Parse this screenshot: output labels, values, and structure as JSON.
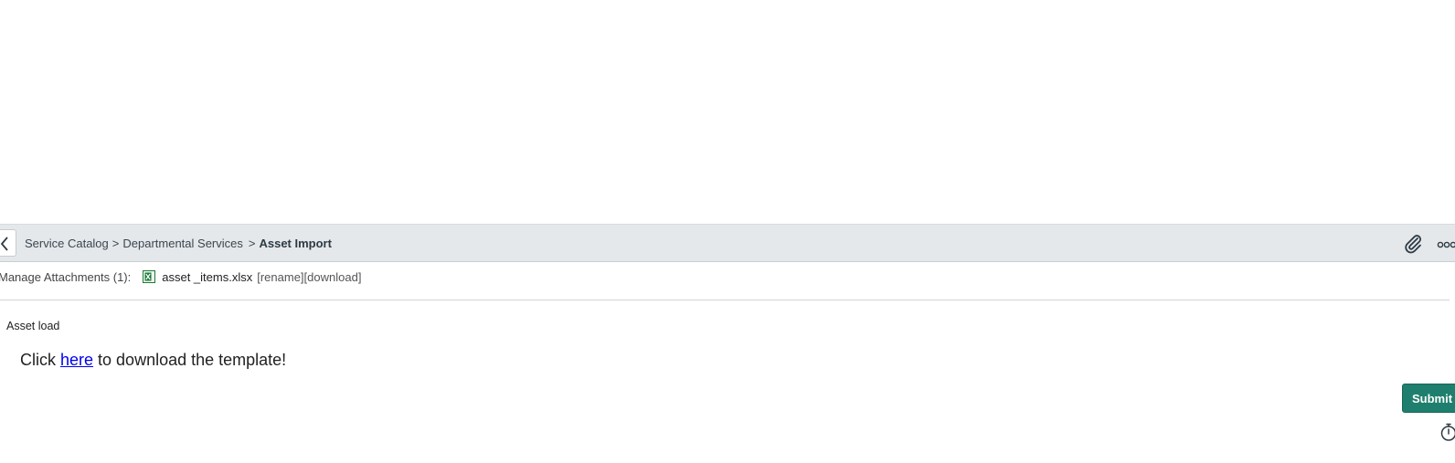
{
  "breadcrumb": {
    "items": [
      "Service Catalog",
      "Departmental Services"
    ],
    "separator": ">",
    "current": "Asset Import"
  },
  "attachments": {
    "label": "Manage Attachments (1):",
    "file_name": "asset _items.xlsx",
    "rename_label": "[rename]",
    "download_label": "[download]",
    "file_icon": "excel-file-icon"
  },
  "form": {
    "section_label": "Asset load",
    "help_prefix": "Click ",
    "help_link": "here",
    "help_suffix": " to download the template!"
  },
  "actions": {
    "submit_label": "Submit"
  },
  "icons": {
    "back": "chevron-left-icon",
    "attach": "paperclip-icon",
    "more": "more-icon",
    "timer": "stopwatch-icon"
  },
  "colors": {
    "header_bg": "#e4e8eb",
    "submit_bg": "#1f7f6e",
    "link": "#0000ee",
    "excel_green": "#1d7a3a"
  }
}
